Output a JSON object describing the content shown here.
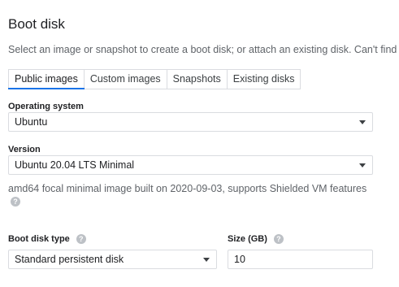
{
  "section": {
    "title": "Boot disk",
    "description": "Select an image or snapshot to create a boot disk; or attach an existing disk. Can't find wl"
  },
  "tabs": [
    {
      "label": "Public images",
      "active": true
    },
    {
      "label": "Custom images",
      "active": false
    },
    {
      "label": "Snapshots",
      "active": false
    },
    {
      "label": "Existing disks",
      "active": false
    }
  ],
  "operating_system": {
    "label": "Operating system",
    "value": "Ubuntu"
  },
  "version": {
    "label": "Version",
    "value": "Ubuntu 20.04 LTS Minimal",
    "hint": "amd64 focal minimal image built on 2020-09-03, supports Shielded VM features"
  },
  "boot_disk_type": {
    "label": "Boot disk type",
    "value": "Standard persistent disk"
  },
  "size": {
    "label": "Size (GB)",
    "value": "10"
  },
  "icons": {
    "help": "help-circle-icon",
    "dropdown": "dropdown-caret-icon"
  },
  "colors": {
    "active_tab_underline": "#1a73e8",
    "border": "#dadce0",
    "help_icon": "#bdc1c6"
  }
}
